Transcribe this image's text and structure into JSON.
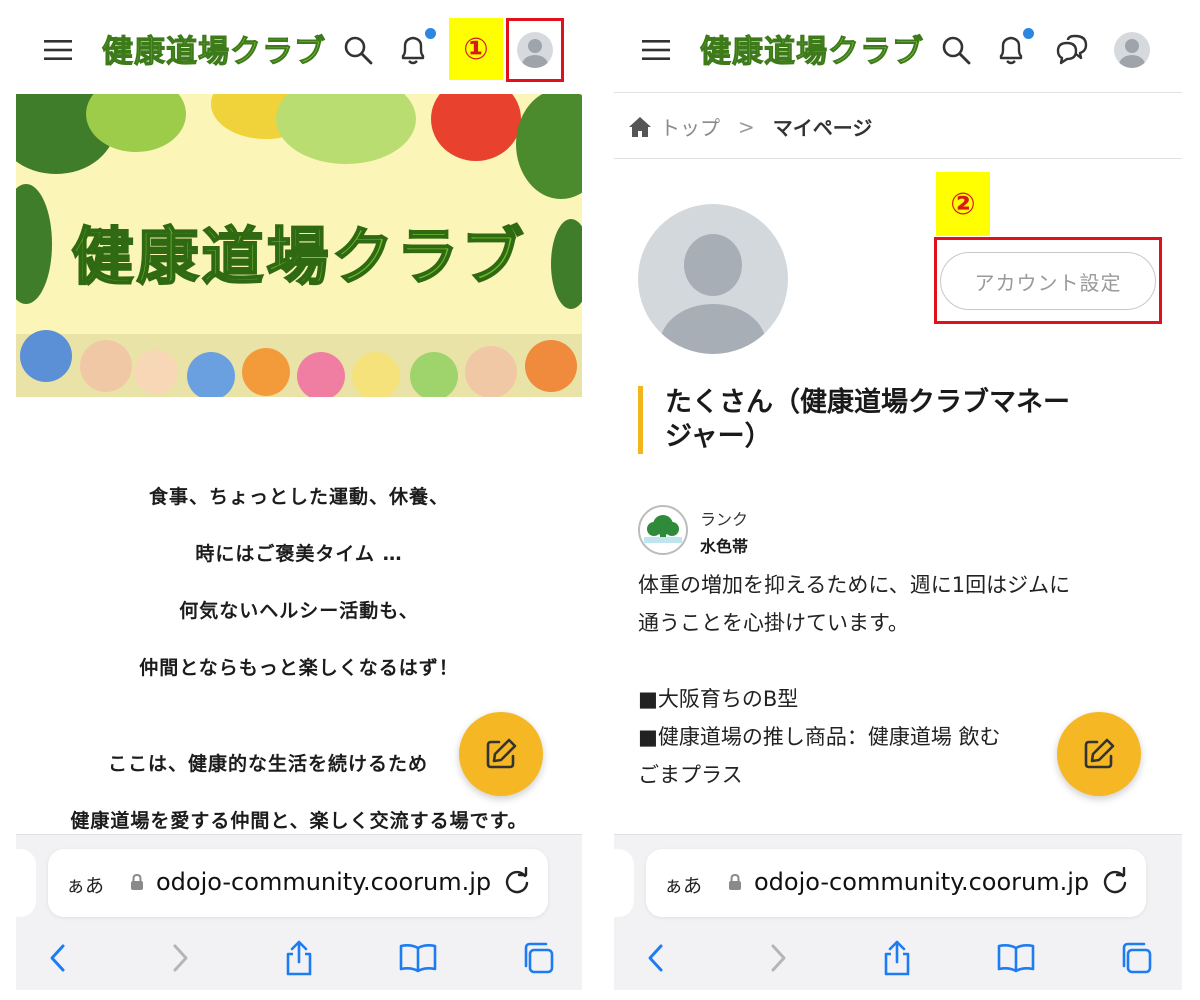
{
  "app": {
    "logo_text": "健康道場クラブ",
    "url_text": "odojo-community.coorum.jp",
    "aa_label": "ぁあ"
  },
  "steps": {
    "step1": "①",
    "step2": "②"
  },
  "left": {
    "banner_title": "健康道場クラブ",
    "intro_lines": [
      "食事、ちょっとした運動、休養、",
      "時にはご褒美タイム …",
      "何気ないヘルシー活動も、",
      "仲間とならもっと楽しくなるはず！",
      "ここは、健康的な生活を続けるため",
      "健康道場を愛する仲間と、楽しく交流する場です。"
    ]
  },
  "right": {
    "breadcrumb": {
      "top": "トップ",
      "separator": ">",
      "current": "マイページ"
    },
    "account_button": "アカウント設定",
    "user_name_line1": "たくさん（健康道場クラブマネー",
    "user_name_line2": "ジャー）",
    "rank_label": "ランク",
    "rank_value": "水色帯",
    "bio_lines": [
      "体重の増加を抑えるために、週に1回はジムに",
      "通うことを心掛けています。",
      "",
      "■大阪育ちのB型",
      "■健康道場の推し商品：健康道場 飲む",
      "ごまプラス"
    ]
  },
  "colors": {
    "accent_yellow": "#f5b724",
    "highlight_red": "#e0111a",
    "ios_blue": "#2e86de",
    "logo_green": "#8cc63f"
  },
  "icons": [
    "menu-icon",
    "search-icon",
    "bell-icon",
    "chat-icon",
    "home-icon",
    "edit-icon",
    "lock-icon",
    "reload-icon",
    "back-icon",
    "forward-icon",
    "share-icon",
    "bookmarks-icon",
    "tabs-icon"
  ]
}
